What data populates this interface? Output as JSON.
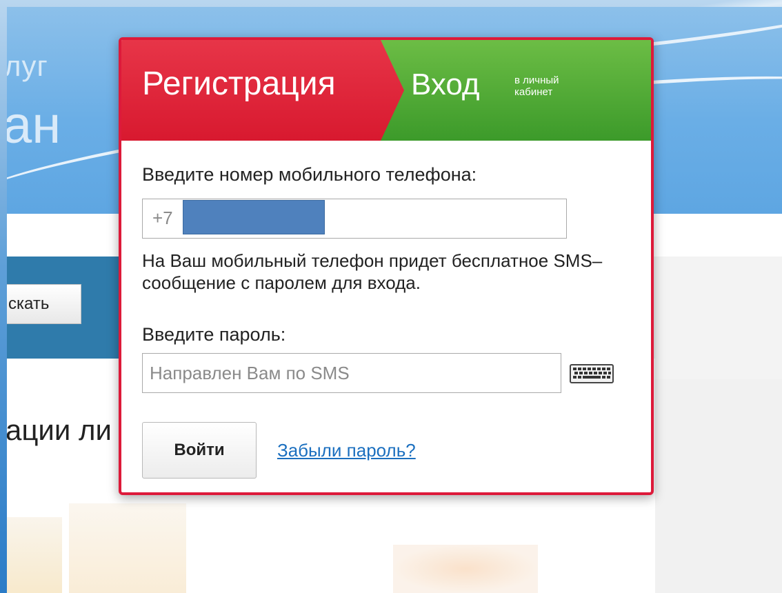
{
  "header": {
    "partial_title_top": "луг",
    "partial_title_big": "ан"
  },
  "search": {
    "button_label": "скать"
  },
  "content": {
    "section_heading_partial": "ации ли"
  },
  "popup": {
    "tabs": {
      "register_label": "Регистрация",
      "login_label": "Вход",
      "login_sublabel": "в личный кабинет",
      "register_color": "#dd1a3a",
      "login_color": "#4aa52f"
    },
    "phone": {
      "label": "Введите номер мобильного телефона:",
      "prefix": "+7"
    },
    "hint": "На Ваш мобильный телефон придет бесплатное SMS–сообщение с паролем для входа.",
    "password": {
      "label": "Введите пароль:",
      "placeholder": "Направлен Вам по SMS",
      "keyboard_icon": "keyboard-icon"
    },
    "login_button_label": "Войти",
    "forgot_link_label": "Забыли пароль?"
  }
}
